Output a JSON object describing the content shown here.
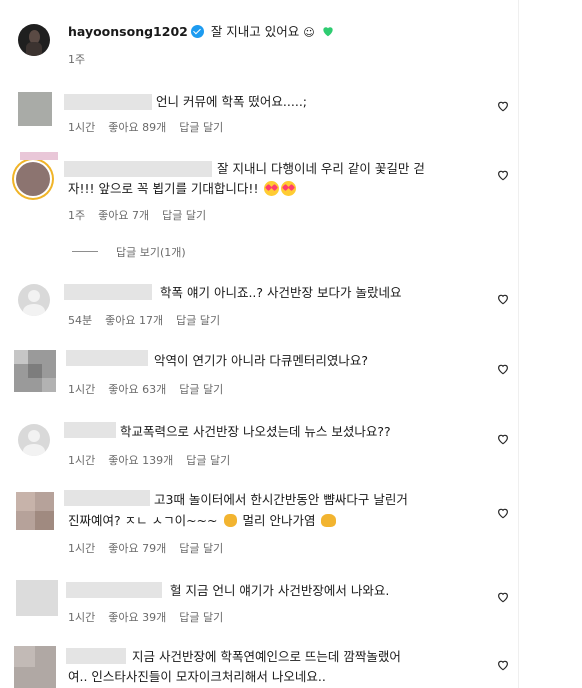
{
  "post_header": {
    "username": "hayoonsong1202",
    "caption": "잘 지내고 있어요",
    "age": "1주"
  },
  "actions": {
    "like_label": "좋아요",
    "reply_label": "답글 달기",
    "view_replies_label": "답글 보기(1개)"
  },
  "comments": [
    {
      "lines": [
        "언니 커뮤에 학폭 떴어요.....;"
      ],
      "time": "1시간",
      "likes": "좋아요 89개",
      "reply": "답글 달기"
    },
    {
      "lines": [
        "잘 지내니 다행이네 우리 같이 꽃길만 걷",
        "자!!! 앞으로 꼭 뵙기를 기대합니다!!"
      ],
      "time": "1주",
      "likes": "좋아요 7개",
      "reply": "답글 달기"
    },
    {
      "lines": [
        "학폭 얘기 아니죠..? 사건반장 보다가 놀랐네요"
      ],
      "time": "54분",
      "likes": "좋아요 17개",
      "reply": "답글 달기"
    },
    {
      "lines": [
        "악역이 연기가 아니라 다큐멘터리였나요?"
      ],
      "time": "1시간",
      "likes": "좋아요 63개",
      "reply": "답글 달기"
    },
    {
      "lines": [
        "학교폭력으로 사건반장 나오셨는데 뉴스 보셨나요??"
      ],
      "time": "1시간",
      "likes": "좋아요 139개",
      "reply": "답글 달기"
    },
    {
      "lines": [
        "고3때 놀이터에서 한시간반동안 뺨싸다구 날린거",
        "진짜예여? ㅈㄴ ㅅㄱ이~~~",
        "멀리 안나가염"
      ],
      "time": "1시간",
      "likes": "좋아요 79개",
      "reply": "답글 달기"
    },
    {
      "lines": [
        "헐 지금 언니 얘기가 사건반장에서 나와요."
      ],
      "time": "1시간",
      "likes": "좋아요 39개",
      "reply": "답글 달기"
    },
    {
      "lines": [
        "지금 사건반장에 학폭연예인으로 뜨는데 깜짝놀랬어",
        "여.. 인스타사진들이 모자이크처리해서 나오네요.."
      ],
      "time": "",
      "likes": "",
      "reply": ""
    }
  ],
  "colors": {
    "text": "#1a1a1a",
    "meta": "#6b6b6b",
    "blur": "#e4e4e4",
    "verified": "#1d9bf0",
    "green_heart": "#2ecc71"
  }
}
